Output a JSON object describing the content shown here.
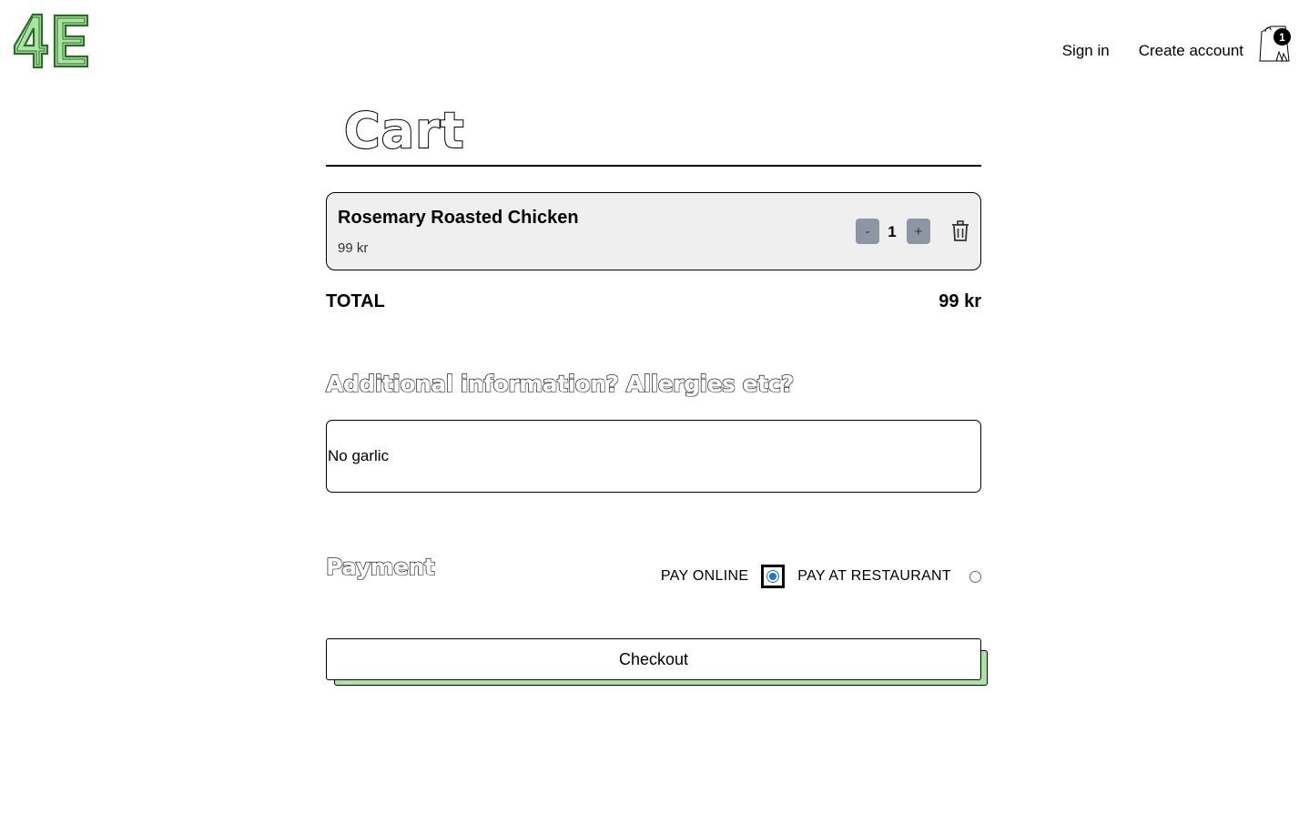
{
  "header": {
    "logo_text": "4E",
    "nav": {
      "sign_in": "Sign in",
      "create_account": "Create account"
    },
    "cart_count": "1"
  },
  "cart": {
    "title": "Cart",
    "items": [
      {
        "name": "Rosemary Roasted Chicken",
        "price": "99 kr",
        "quantity": "1",
        "minus_label": "-",
        "plus_label": "+"
      }
    ],
    "total_label": "TOTAL",
    "total_value": "99 kr"
  },
  "additional_info": {
    "heading": "Additional information? Allergies etc?",
    "value": "No garlic"
  },
  "payment": {
    "heading": "Payment",
    "options": [
      {
        "label": "PAY ONLINE",
        "selected": true
      },
      {
        "label": "PAY AT RESTAURANT",
        "selected": false
      }
    ]
  },
  "checkout_label": "Checkout",
  "colors": {
    "accent_green": "#a8e6a0",
    "radio_blue": "#1a73e8",
    "item_bg": "#efefef",
    "qty_button": "#8e96a3"
  }
}
